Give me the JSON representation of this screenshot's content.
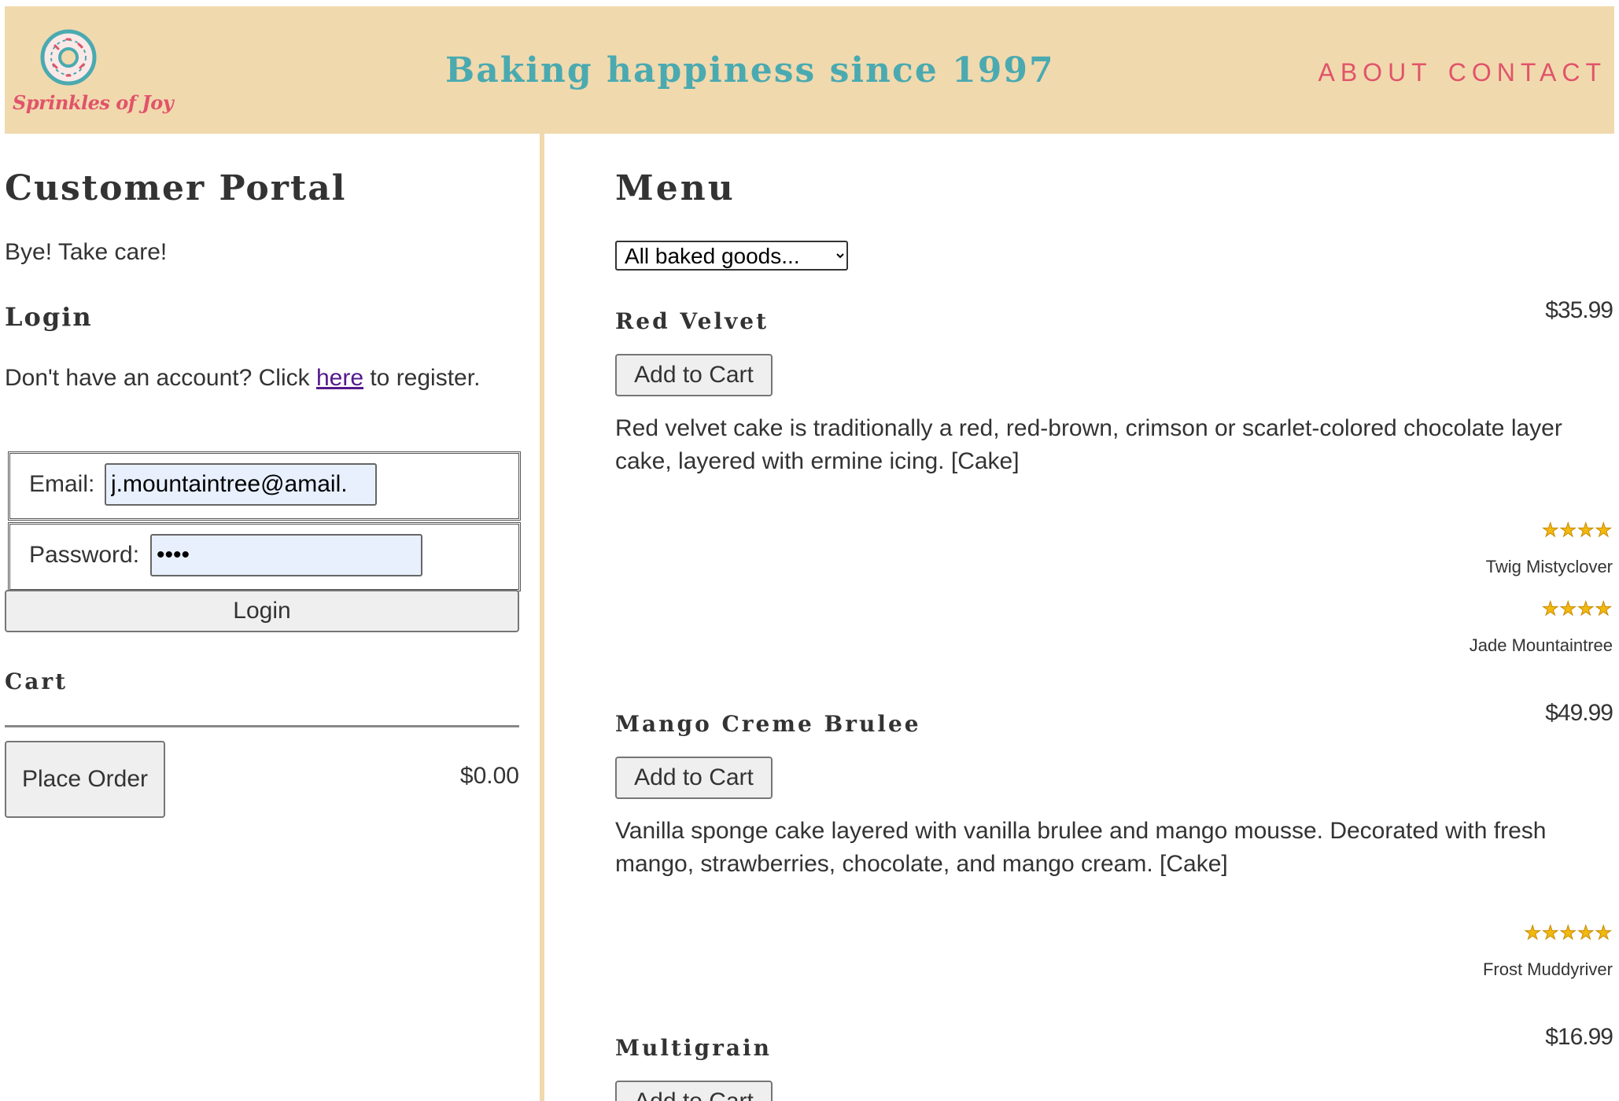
{
  "header": {
    "logo_text": "Sprinkles of Joy",
    "tagline": "Baking happiness since 1997",
    "nav": [
      "ABOUT",
      "CONTACT"
    ],
    "colors": {
      "band": "#f1d9ae",
      "teal": "#4aaab0",
      "pink": "#e0546a"
    }
  },
  "portal": {
    "title": "Customer Portal",
    "message": "Bye! Take care!",
    "login_heading": "Login",
    "register_prefix": "Don't have an account? Click ",
    "register_link": "here",
    "register_suffix": " to register.",
    "email_label": "Email:",
    "email_value": "j.mountaintree@amail.",
    "password_label": "Password:",
    "password_value": "••••",
    "login_button": "Login",
    "cart_heading": "Cart",
    "place_order": "Place Order",
    "cart_total": "$0.00"
  },
  "menu": {
    "title": "Menu",
    "filter_selected": "All baked goods...",
    "add_label": "Add to Cart",
    "items": [
      {
        "name": "Red Velvet",
        "price": "$35.99",
        "description": "Red velvet cake is traditionally a red, red-brown, crimson or scarlet-colored chocolate layer cake, layered with ermine icing. [Cake]",
        "reviews": [
          {
            "stars": 4,
            "stars_text": "★★★★",
            "reviewer": "Twig Mistyclover"
          },
          {
            "stars": 4,
            "stars_text": "★★★★",
            "reviewer": "Jade Mountaintree"
          }
        ]
      },
      {
        "name": "Mango Creme Brulee",
        "price": "$49.99",
        "description": "Vanilla sponge cake layered with vanilla brulee and mango mousse. Decorated with fresh mango, strawberries, chocolate, and mango cream. [Cake]",
        "reviews": [
          {
            "stars": 5,
            "stars_text": "★★★★★",
            "reviewer": "Frost Muddyriver"
          }
        ]
      },
      {
        "name": "Multigrain",
        "price": "$16.99"
      }
    ]
  }
}
